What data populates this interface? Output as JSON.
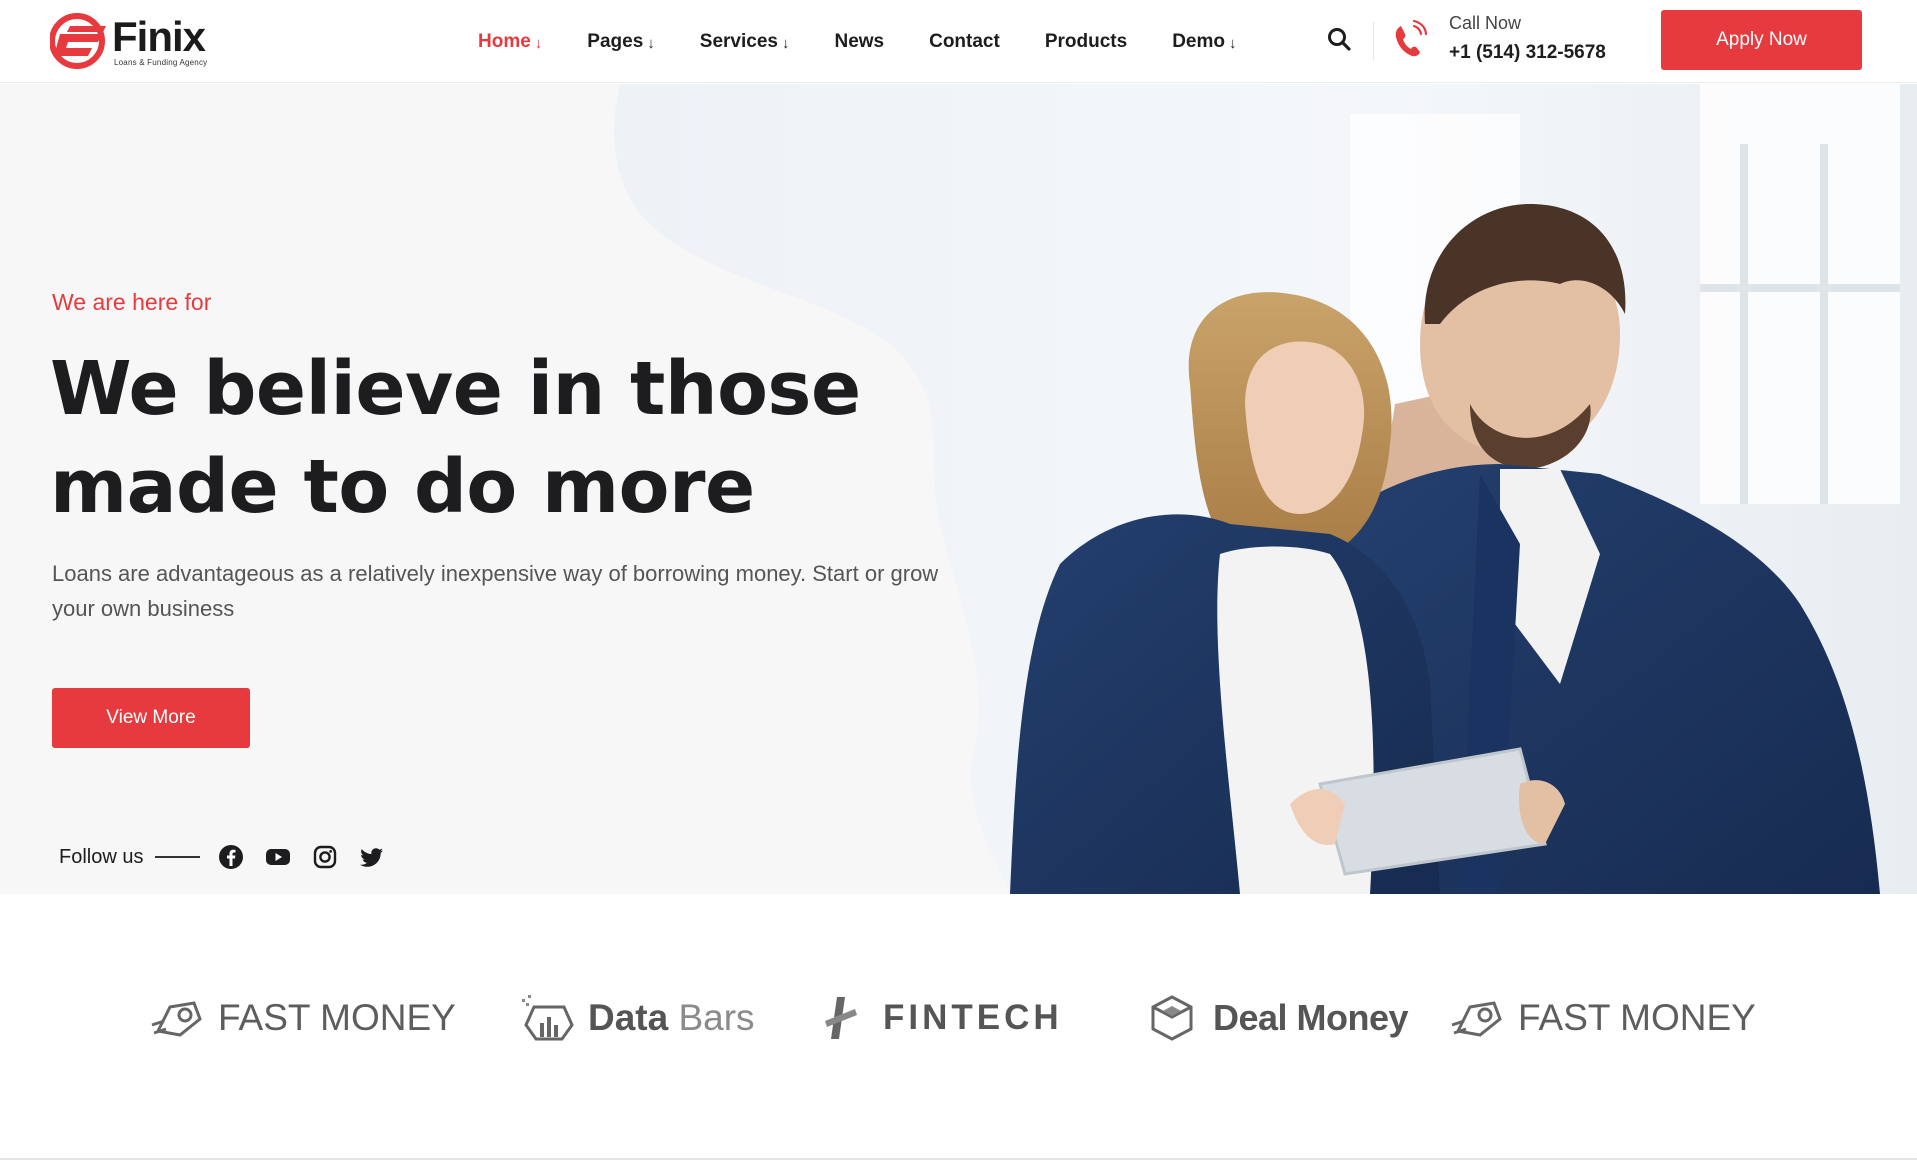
{
  "colors": {
    "accent": "#e63a3f",
    "text": "#1d1d1f",
    "muted": "#555555",
    "jacket": "#1e3562"
  },
  "header": {
    "logo": {
      "name": "Finix",
      "tagline": "Loans & Funding Agency"
    },
    "nav": [
      {
        "label": "Home",
        "dropdown": true,
        "active": true
      },
      {
        "label": "Pages",
        "dropdown": true
      },
      {
        "label": "Services",
        "dropdown": true
      },
      {
        "label": "News",
        "dropdown": false
      },
      {
        "label": "Contact",
        "dropdown": false
      },
      {
        "label": "Products",
        "dropdown": false
      },
      {
        "label": "Demo",
        "dropdown": true
      }
    ],
    "arrow": "↓",
    "call": {
      "label": "Call Now",
      "number": "+1 (514) 312-5678"
    },
    "apply_label": "Apply Now"
  },
  "hero": {
    "eyebrow": "We are here for",
    "headline_line1": "We believe in those",
    "headline_line2": "made to do more",
    "subtext": "Loans are advantageous as a relatively inexpensive way of borrowing money. Start or grow your own business",
    "cta_label": "View More",
    "follow_label": "Follow us",
    "socials": [
      "facebook-icon",
      "youtube-icon",
      "instagram-icon",
      "twitter-icon"
    ]
  },
  "brands": [
    {
      "icon": "fast-money-logo-icon",
      "text": "FAST MONEY"
    },
    {
      "icon": "data-bars-logo-icon",
      "text_strong": "Data",
      "text_light": "Bars"
    },
    {
      "icon": "fintech-logo-icon",
      "text": "FINTECH"
    },
    {
      "icon": "deal-money-logo-icon",
      "text": "Deal Money"
    },
    {
      "icon": "fast-money-logo-icon",
      "text": "FAST MONEY"
    }
  ]
}
